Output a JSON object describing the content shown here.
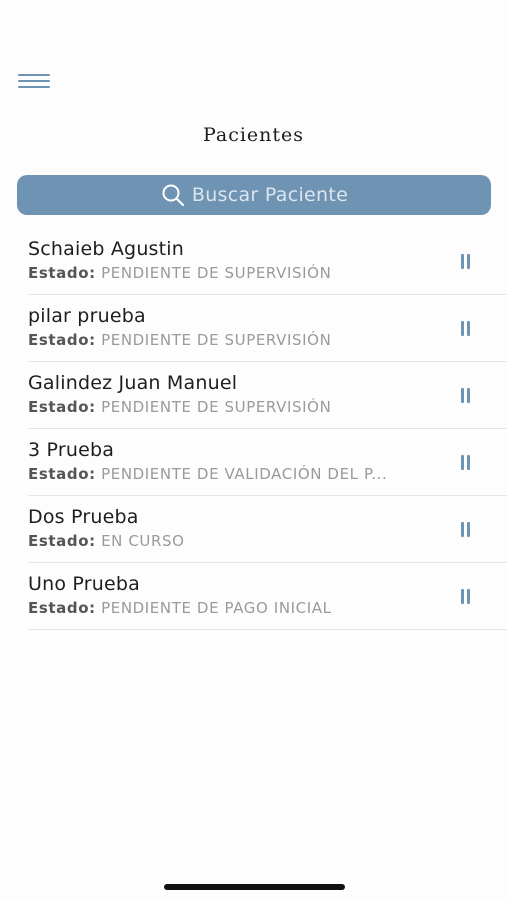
{
  "header": {
    "menu_icon": "hamburger-menu-icon",
    "title": "Pacientes"
  },
  "search": {
    "icon": "search-icon",
    "placeholder": "Buscar Paciente",
    "background_color": "#6f93b3"
  },
  "patients": [
    {
      "name": "Schaieb Agustin",
      "status_label": "Estado:",
      "status": "PENDIENTE DE SUPERVISIÓN",
      "action_icon": "pause-icon"
    },
    {
      "name": "pilar prueba",
      "status_label": "Estado:",
      "status": "PENDIENTE DE SUPERVISIÓN",
      "action_icon": "pause-icon"
    },
    {
      "name": "Galindez Juan Manuel",
      "status_label": "Estado:",
      "status": "PENDIENTE DE SUPERVISIÓN",
      "action_icon": "pause-icon"
    },
    {
      "name": "3 Prueba",
      "status_label": "Estado:",
      "status": "PENDIENTE DE VALIDACIÓN DEL P...",
      "action_icon": "pause-icon"
    },
    {
      "name": "Dos Prueba",
      "status_label": "Estado:",
      "status": "EN CURSO",
      "action_icon": "pause-icon"
    },
    {
      "name": "Uno Prueba",
      "status_label": "Estado:",
      "status": "PENDIENTE DE PAGO INICIAL",
      "action_icon": "pause-icon"
    }
  ],
  "colors": {
    "accent": "#6f93b3",
    "status_text": "#9a9a9a"
  }
}
